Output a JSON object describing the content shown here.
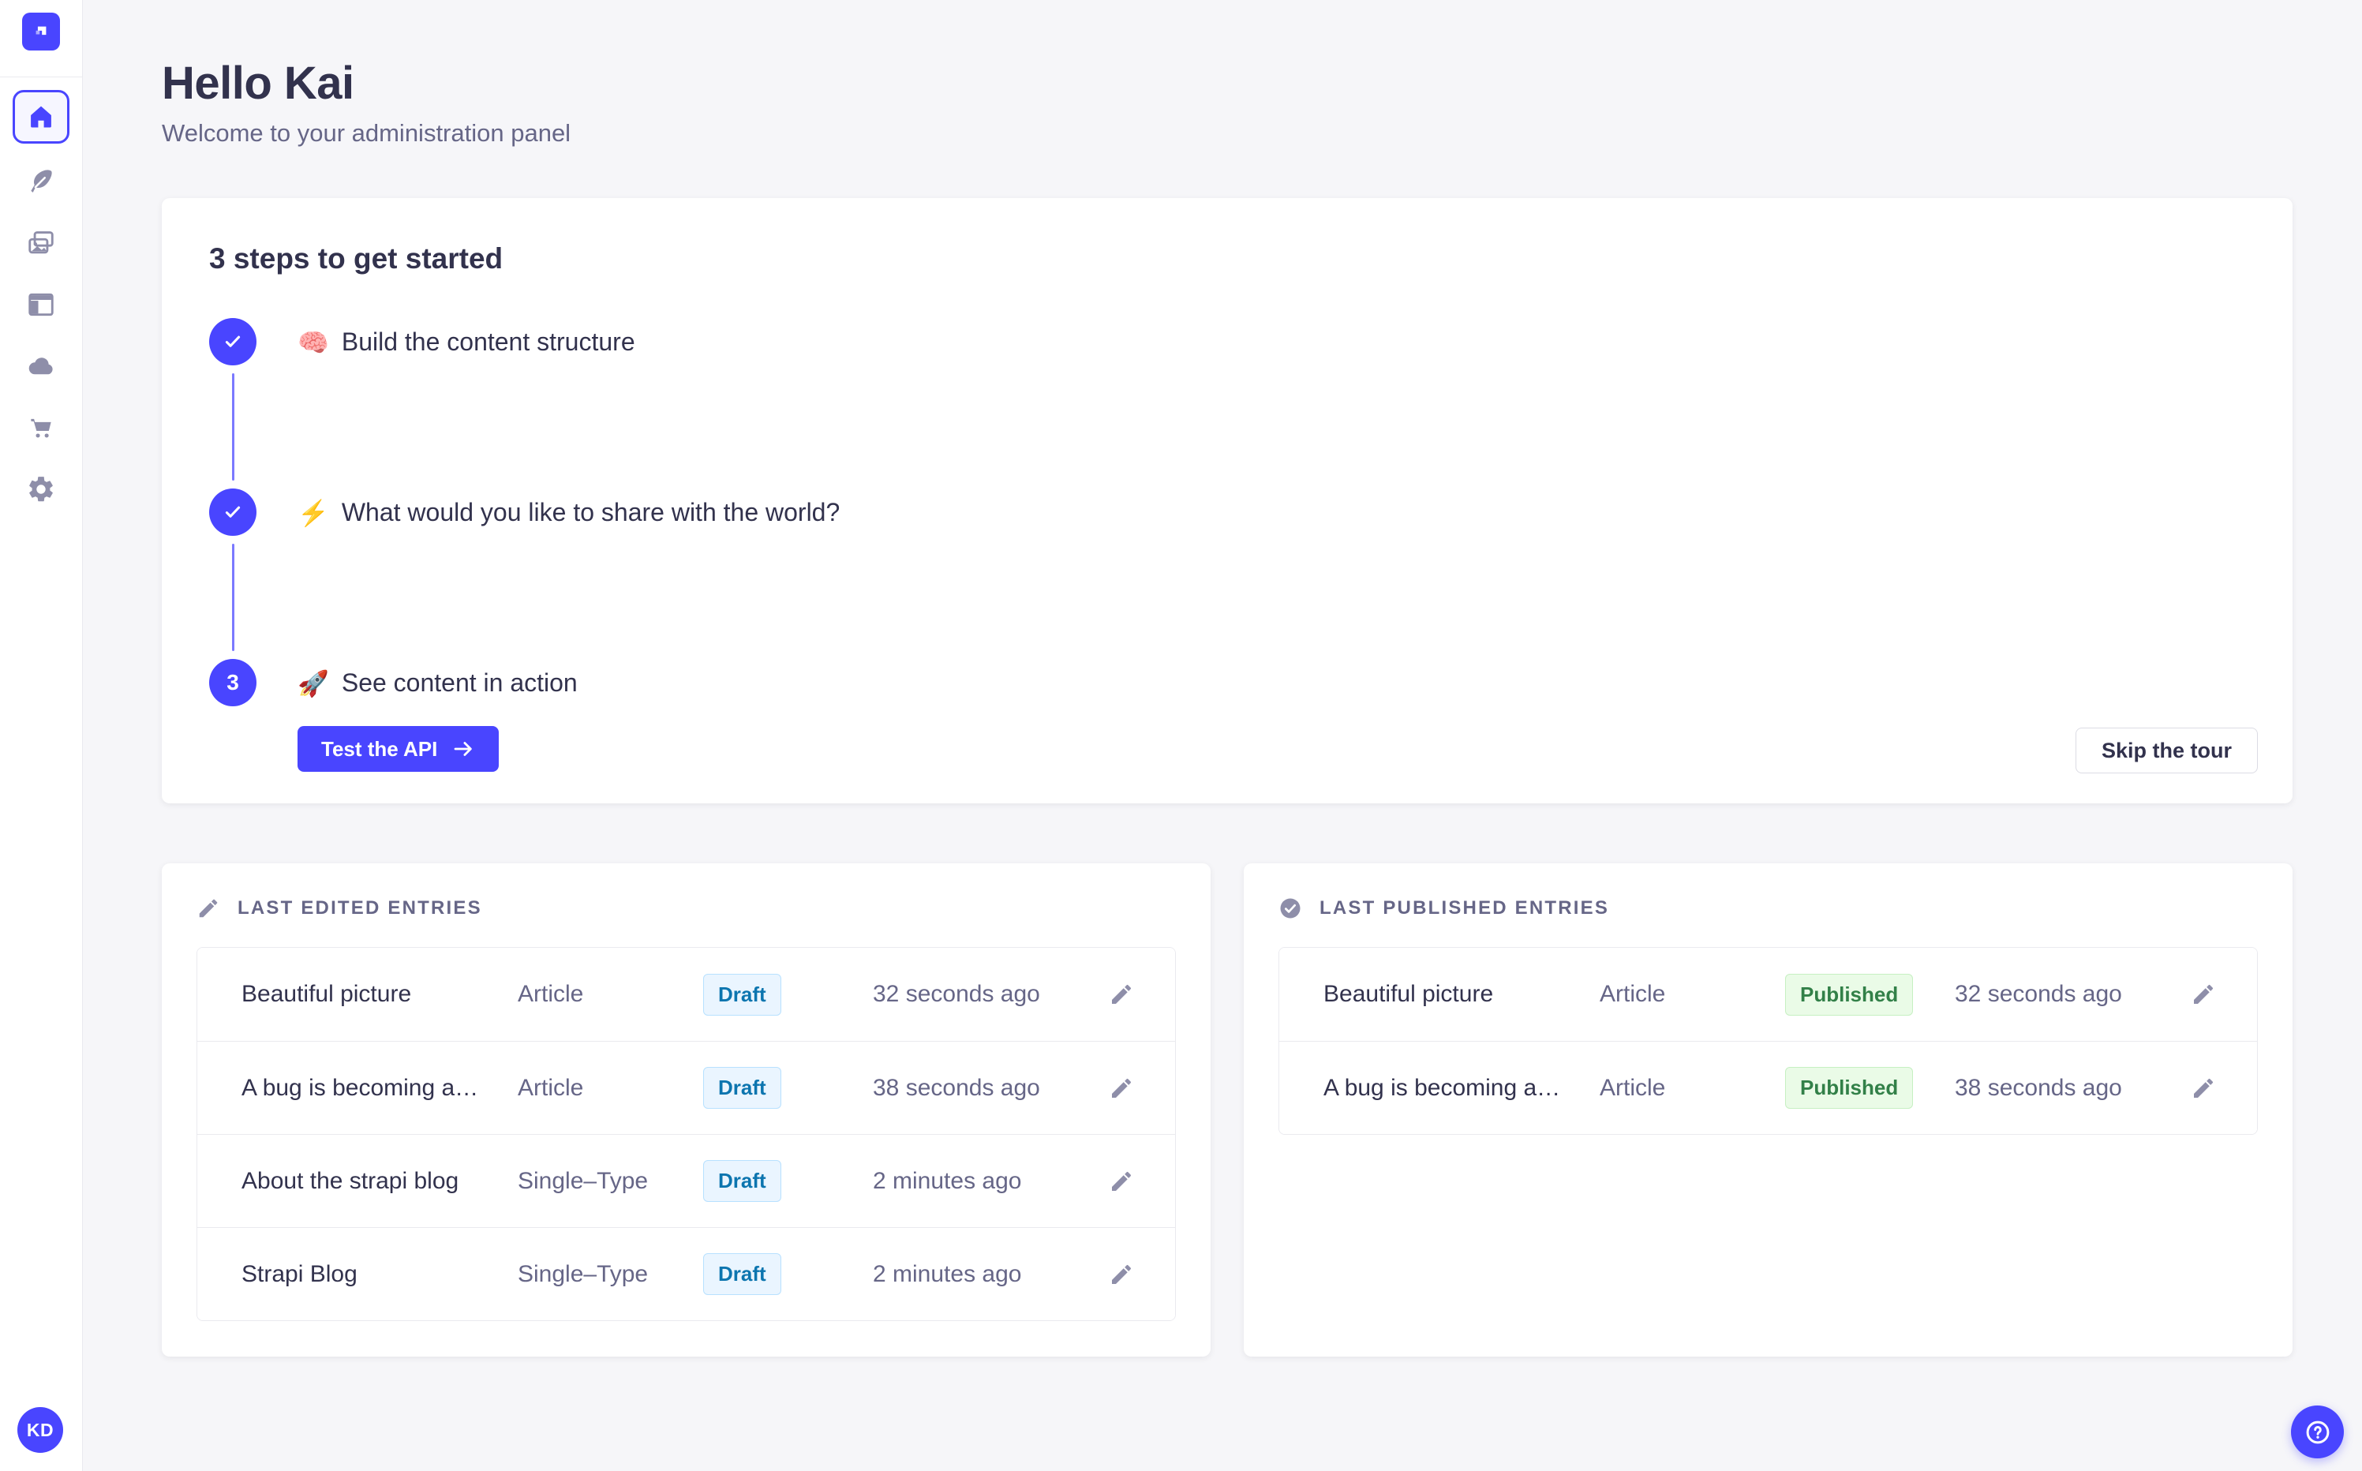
{
  "colors": {
    "primary": "#4945ff",
    "primary_light": "#7b79ff",
    "background": "#f6f6f9",
    "text_dark": "#32324d",
    "text_muted": "#666687",
    "icon_gray": "#8e8ea9",
    "draft_bg": "#eaf5ff",
    "draft_border": "#b8e1ff",
    "draft_text": "#0c75af",
    "published_bg": "#eafbe7",
    "published_border": "#c6f0c2",
    "published_text": "#328048"
  },
  "sidebar": {
    "items": [
      {
        "icon": "home-icon",
        "active": true
      },
      {
        "icon": "feather-icon",
        "active": false
      },
      {
        "icon": "media-pictures-icon",
        "active": false
      },
      {
        "icon": "layout-icon",
        "active": false
      },
      {
        "icon": "cloud-icon",
        "active": false
      },
      {
        "icon": "cart-icon",
        "active": false
      },
      {
        "icon": "gear-icon",
        "active": false
      }
    ],
    "avatar_initials": "KD"
  },
  "header": {
    "title": "Hello Kai",
    "subtitle": "Welcome to your administration panel"
  },
  "onboarding": {
    "title": "3 steps to get started",
    "steps": [
      {
        "number": 1,
        "done": true,
        "emoji": "🧠",
        "label": "Build the content structure"
      },
      {
        "number": 2,
        "done": true,
        "emoji": "⚡",
        "label": "What would you like to share with the world?"
      },
      {
        "number": 3,
        "done": false,
        "emoji": "🚀",
        "label": "See content in action",
        "cta": "Test the API"
      }
    ],
    "skip_label": "Skip the tour"
  },
  "last_edited": {
    "title": "LAST EDITED ENTRIES",
    "rows": [
      {
        "title": "Beautiful picture",
        "type": "Article",
        "status": "Draft",
        "time": "32 seconds ago"
      },
      {
        "title": "A bug is becoming a…",
        "type": "Article",
        "status": "Draft",
        "time": "38 seconds ago"
      },
      {
        "title": "About the strapi blog",
        "type": "Single–Type",
        "status": "Draft",
        "time": "2 minutes ago"
      },
      {
        "title": "Strapi Blog",
        "type": "Single–Type",
        "status": "Draft",
        "time": "2 minutes ago"
      }
    ]
  },
  "last_published": {
    "title": "LAST PUBLISHED ENTRIES",
    "rows": [
      {
        "title": "Beautiful picture",
        "type": "Article",
        "status": "Published",
        "time": "32 seconds ago"
      },
      {
        "title": "A bug is becoming a…",
        "type": "Article",
        "status": "Published",
        "time": "38 seconds ago"
      }
    ]
  }
}
